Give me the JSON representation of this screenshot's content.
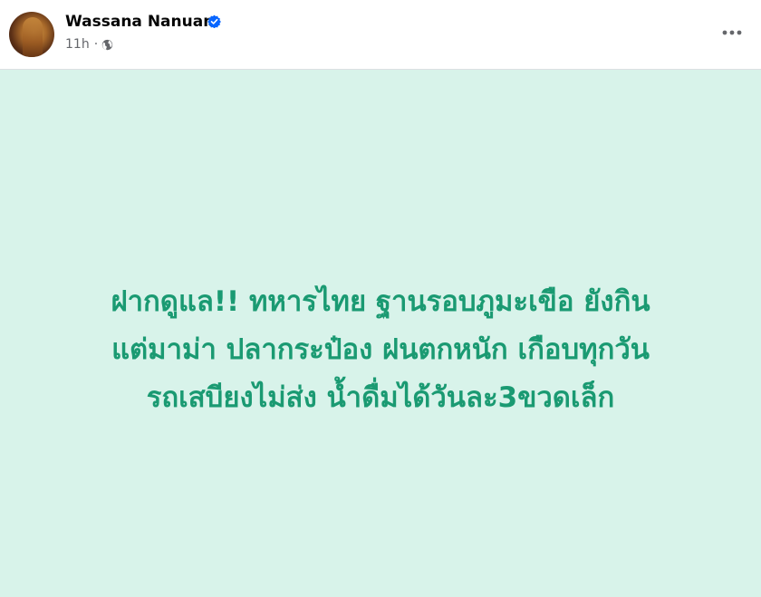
{
  "author": {
    "name": "Wassana Nanuam",
    "verified": true
  },
  "meta": {
    "time": "11h",
    "separator": "·",
    "audience_icon": "globe-icon"
  },
  "menu": {
    "icon": "more-horizontal-icon"
  },
  "post": {
    "background_color": "#d8f3ea",
    "text_color": "#1a9a72",
    "lines": [
      "ฝากดูแล!! ทหารไทย ฐานรอบภูมะเขือ ยังกิน",
      "แต่มาม่า ปลากระป๋อง ฝนตกหนัก เกือบทุกวัน",
      "รถเสบียงไม่ส่ง น้ำดื่มได้วันละ3ขวดเล็ก"
    ]
  },
  "colors": {
    "verified_badge": "#0866ff",
    "meta_text": "#65676b",
    "name_text": "#050505"
  }
}
